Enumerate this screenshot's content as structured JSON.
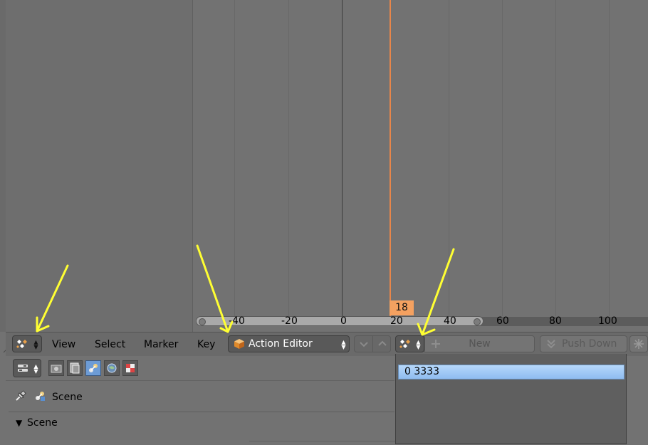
{
  "timeline": {
    "current_frame": "18",
    "ticks": [
      "-40",
      "-20",
      "0",
      "20",
      "40",
      "60",
      "80",
      "100"
    ]
  },
  "header": {
    "menus": [
      "View",
      "Select",
      "Marker",
      "Key"
    ],
    "mode_label": "Action Editor",
    "new_label": "New",
    "push_down_label": "Push Down"
  },
  "properties": {
    "context_label": "Scene",
    "panel_title": "Scene"
  },
  "popup": {
    "items": [
      "0 3333"
    ]
  },
  "colors": {
    "playhead": "#e8864a",
    "frame_badge": "#f4a160",
    "annotation_arrow": "#ffff33",
    "selected_item": "#a8cdf7"
  }
}
